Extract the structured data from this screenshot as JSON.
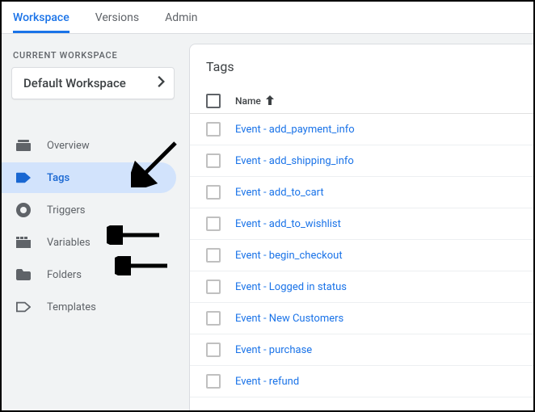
{
  "tabs": {
    "workspace": "Workspace",
    "versions": "Versions",
    "admin": "Admin"
  },
  "workspace": {
    "label": "CURRENT WORKSPACE",
    "name": "Default Workspace"
  },
  "nav": {
    "overview": "Overview",
    "tags": "Tags",
    "triggers": "Triggers",
    "variables": "Variables",
    "folders": "Folders",
    "templates": "Templates"
  },
  "content": {
    "title": "Tags",
    "col_name": "Name",
    "rows": [
      "Event - add_payment_info",
      "Event - add_shipping_info",
      "Event - add_to_cart",
      "Event - add_to_wishlist",
      "Event - begin_checkout",
      "Event - Logged in status",
      "Event - New Customers",
      "Event - purchase",
      "Event - refund"
    ]
  }
}
